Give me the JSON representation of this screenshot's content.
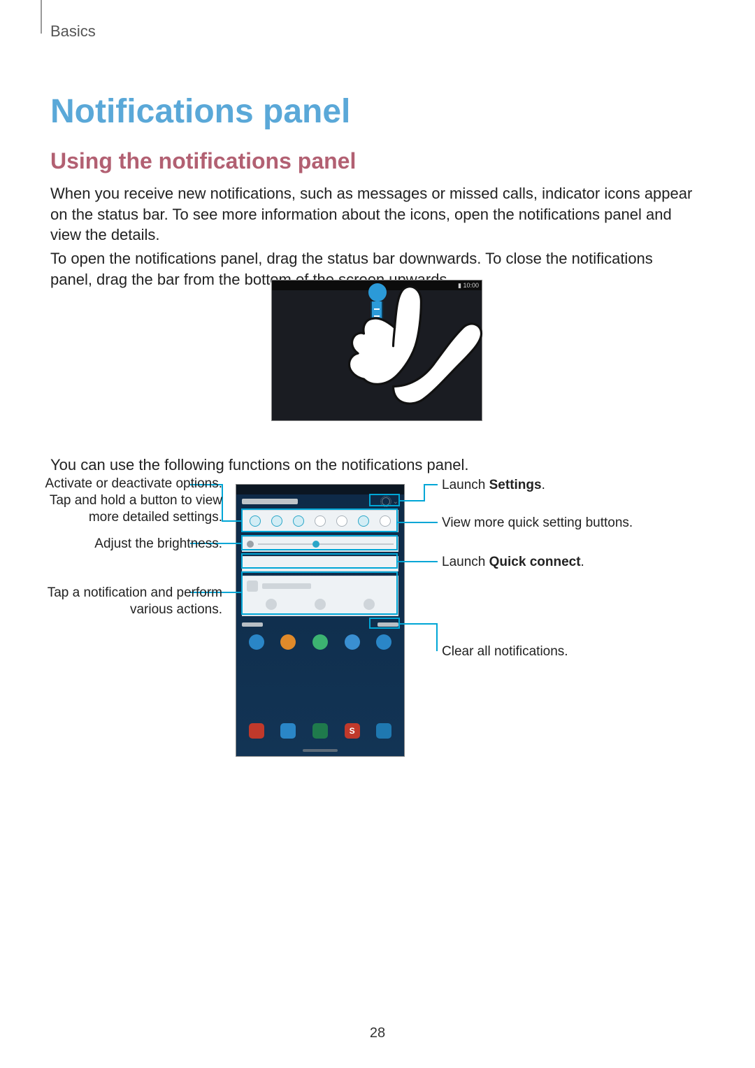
{
  "header": {
    "breadcrumb": "Basics"
  },
  "title": "Notifications panel",
  "subtitle": "Using the notifications panel",
  "paragraphs": {
    "p1": "When you receive new notifications, such as messages or missed calls, indicator icons appear on the status bar. To see more information about the icons, open the notifications panel and view the details.",
    "p2": "To open the notifications panel, drag the status bar downwards. To close the notifications panel, drag the bar from the bottom of the screen upwards.",
    "p3": "You can use the following functions on the notifications panel."
  },
  "figure1": {
    "status_time": "10:00"
  },
  "callouts": {
    "left": {
      "activate": "Activate or deactivate options. Tap and hold a button to view more detailed settings.",
      "brightness": "Adjust the brightness.",
      "notification": "Tap a notification and perform various actions."
    },
    "right": {
      "settings_pre": "Launch ",
      "settings_bold": "Settings",
      "settings_post": ".",
      "viewmore": "View more quick setting buttons.",
      "quickconnect_pre": "Launch ",
      "quickconnect_bold": "Quick connect",
      "quickconnect_post": ".",
      "clear": "Clear all notifications."
    }
  },
  "page_number": "28",
  "icons": {
    "wifi": "wifi-icon",
    "location": "location-icon",
    "sound": "sound-icon",
    "rotate": "rotate-icon",
    "bluetooth": "bluetooth-icon",
    "mobiledata": "mobile-data-icon",
    "torch": "torch-icon"
  }
}
